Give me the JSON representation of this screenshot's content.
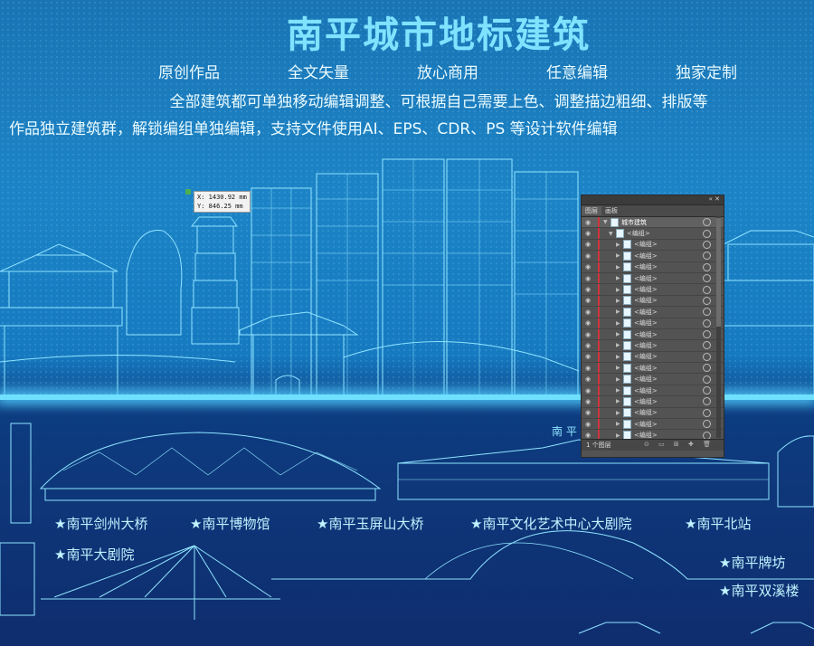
{
  "header": {
    "title": "南平城市地标建筑",
    "features": [
      "原创作品",
      "全文矢量",
      "放心商用",
      "任意编辑",
      "独家定制"
    ],
    "desc_line1": "全部建筑都可单独移动编辑调整、可根据自己需要上色、调整描边粗细、排版等",
    "desc_line2": "作品独立建筑群，解锁编组单独编辑，支持文件使用AI、EPS、CDR、PS 等设计软件编辑"
  },
  "tooltip": {
    "x": "X: 1430.92 mm",
    "y": "Y: 846.25 mm"
  },
  "river_sign": "南 平",
  "labels": [
    "★南平剑州大桥",
    "★南平博物馆",
    "★南平玉屏山大桥",
    "★南平文化艺术中心大剧院",
    "★南平北站",
    "★南平大剧院",
    "★南平牌坊",
    "★南平双溪楼"
  ],
  "layers_panel": {
    "tabs": [
      "图层",
      "画板"
    ],
    "top_layer": "城市建筑",
    "group_label": "<编组>",
    "footer": "1 个图层",
    "footer_icons": "⊙ ▭ ⊞ ✚ 🗑"
  },
  "colors": {
    "accent": "#7fe3ff",
    "line": "#8fe4ff",
    "panel": "#535353",
    "layer_marker": "#d0343c"
  }
}
